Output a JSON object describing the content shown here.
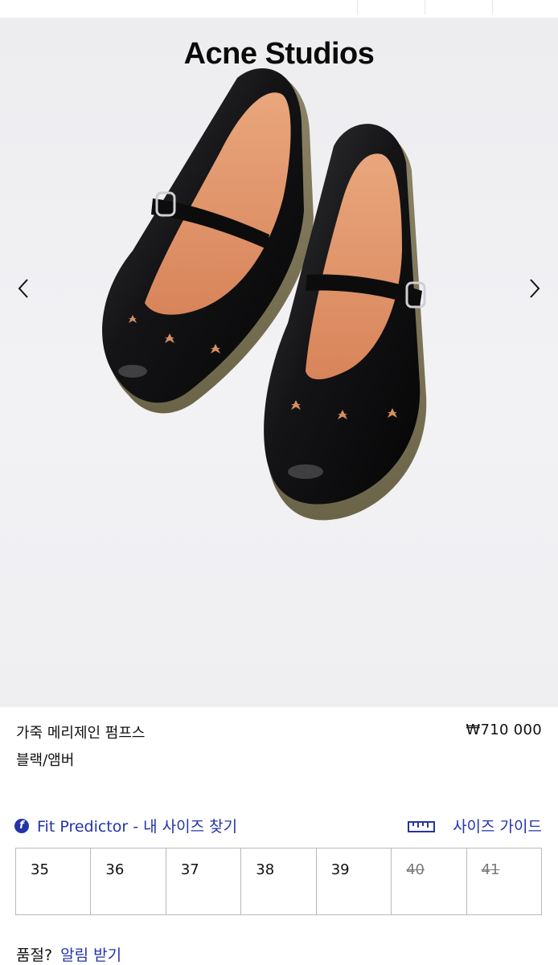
{
  "brand": "Acne Studios",
  "product": {
    "name": "가죽 메리제인 펌프스",
    "color": "블랙/앰버",
    "price": "₩710 000"
  },
  "fit_predictor": {
    "label": "Fit Predictor - 내 사이즈 찾기"
  },
  "size_guide": {
    "label": "사이즈 가이드"
  },
  "sizes": [
    {
      "label": "35",
      "available": true
    },
    {
      "label": "36",
      "available": true
    },
    {
      "label": "37",
      "available": true
    },
    {
      "label": "38",
      "available": true
    },
    {
      "label": "39",
      "available": true
    },
    {
      "label": "40",
      "available": false
    },
    {
      "label": "41",
      "available": false
    }
  ],
  "soldout": {
    "question": "품절?",
    "link": "알림 받기"
  },
  "colors": {
    "accent": "#2433a8",
    "hero_bg": "#efeff2"
  }
}
